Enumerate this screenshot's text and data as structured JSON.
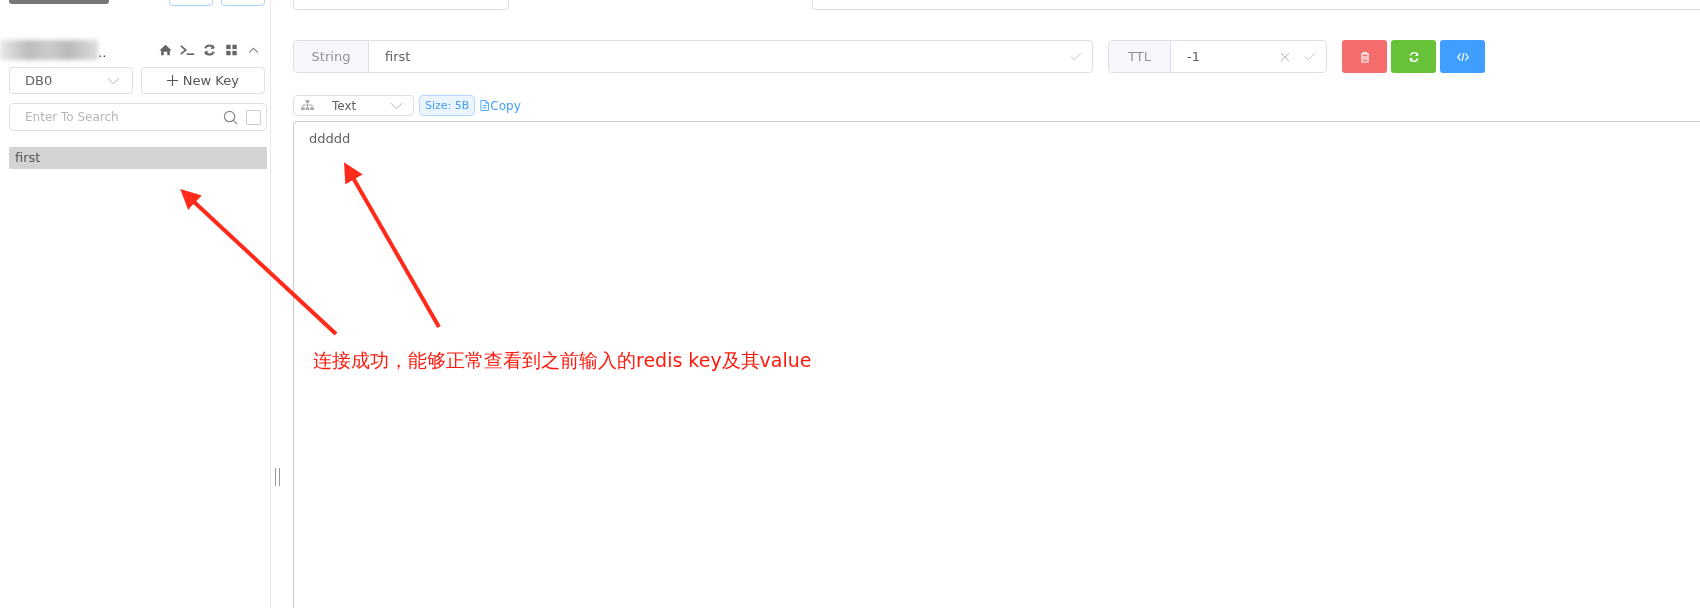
{
  "connection": {
    "name": ".."
  },
  "sidebar": {
    "db_select": {
      "value": "DB0"
    },
    "new_key_button": {
      "label": "New Key"
    },
    "search": {
      "placeholder": "Enter To Search",
      "exact_match_checked": false
    },
    "keys": [
      {
        "label": "first",
        "selected": true
      }
    ]
  },
  "key_detail": {
    "type": "String",
    "key_name": "first",
    "ttl_label": "TTL",
    "ttl_value": "-1",
    "format_select": {
      "value": "Text"
    },
    "size": "Size: 5B",
    "copy_link": "Copy",
    "value": "ddddd"
  },
  "annotation": {
    "text": "连接成功，能够正常查看到之前输入的redis key及其value"
  }
}
